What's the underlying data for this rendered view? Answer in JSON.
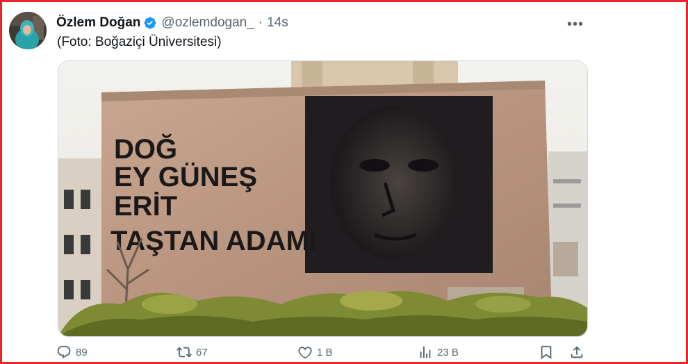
{
  "tweet": {
    "author_name": "Özlem Doğan",
    "handle": "@ozlemdogan_",
    "separator": "·",
    "time": "14s",
    "text": "(Foto: Boğaziçi Üniversitesi)",
    "more_glyph": "•••"
  },
  "image": {
    "graffiti_lines": [
      "DOĞ",
      "EY GÜNEŞ",
      "ERİT",
      "TAŞTAN ADAMI"
    ]
  },
  "actions": {
    "replies": "89",
    "retweets": "67",
    "likes": "1 B",
    "views": "23 B"
  },
  "icons": {
    "verified": "verified-badge-icon",
    "reply": "reply-icon",
    "retweet": "retweet-icon",
    "like": "heart-icon",
    "views": "views-bar-chart-icon",
    "bookmark": "bookmark-icon",
    "share": "share-icon"
  },
  "colors": {
    "border": "#e8262b",
    "verified": "#1d9bf0",
    "muted_text": "#536471"
  }
}
